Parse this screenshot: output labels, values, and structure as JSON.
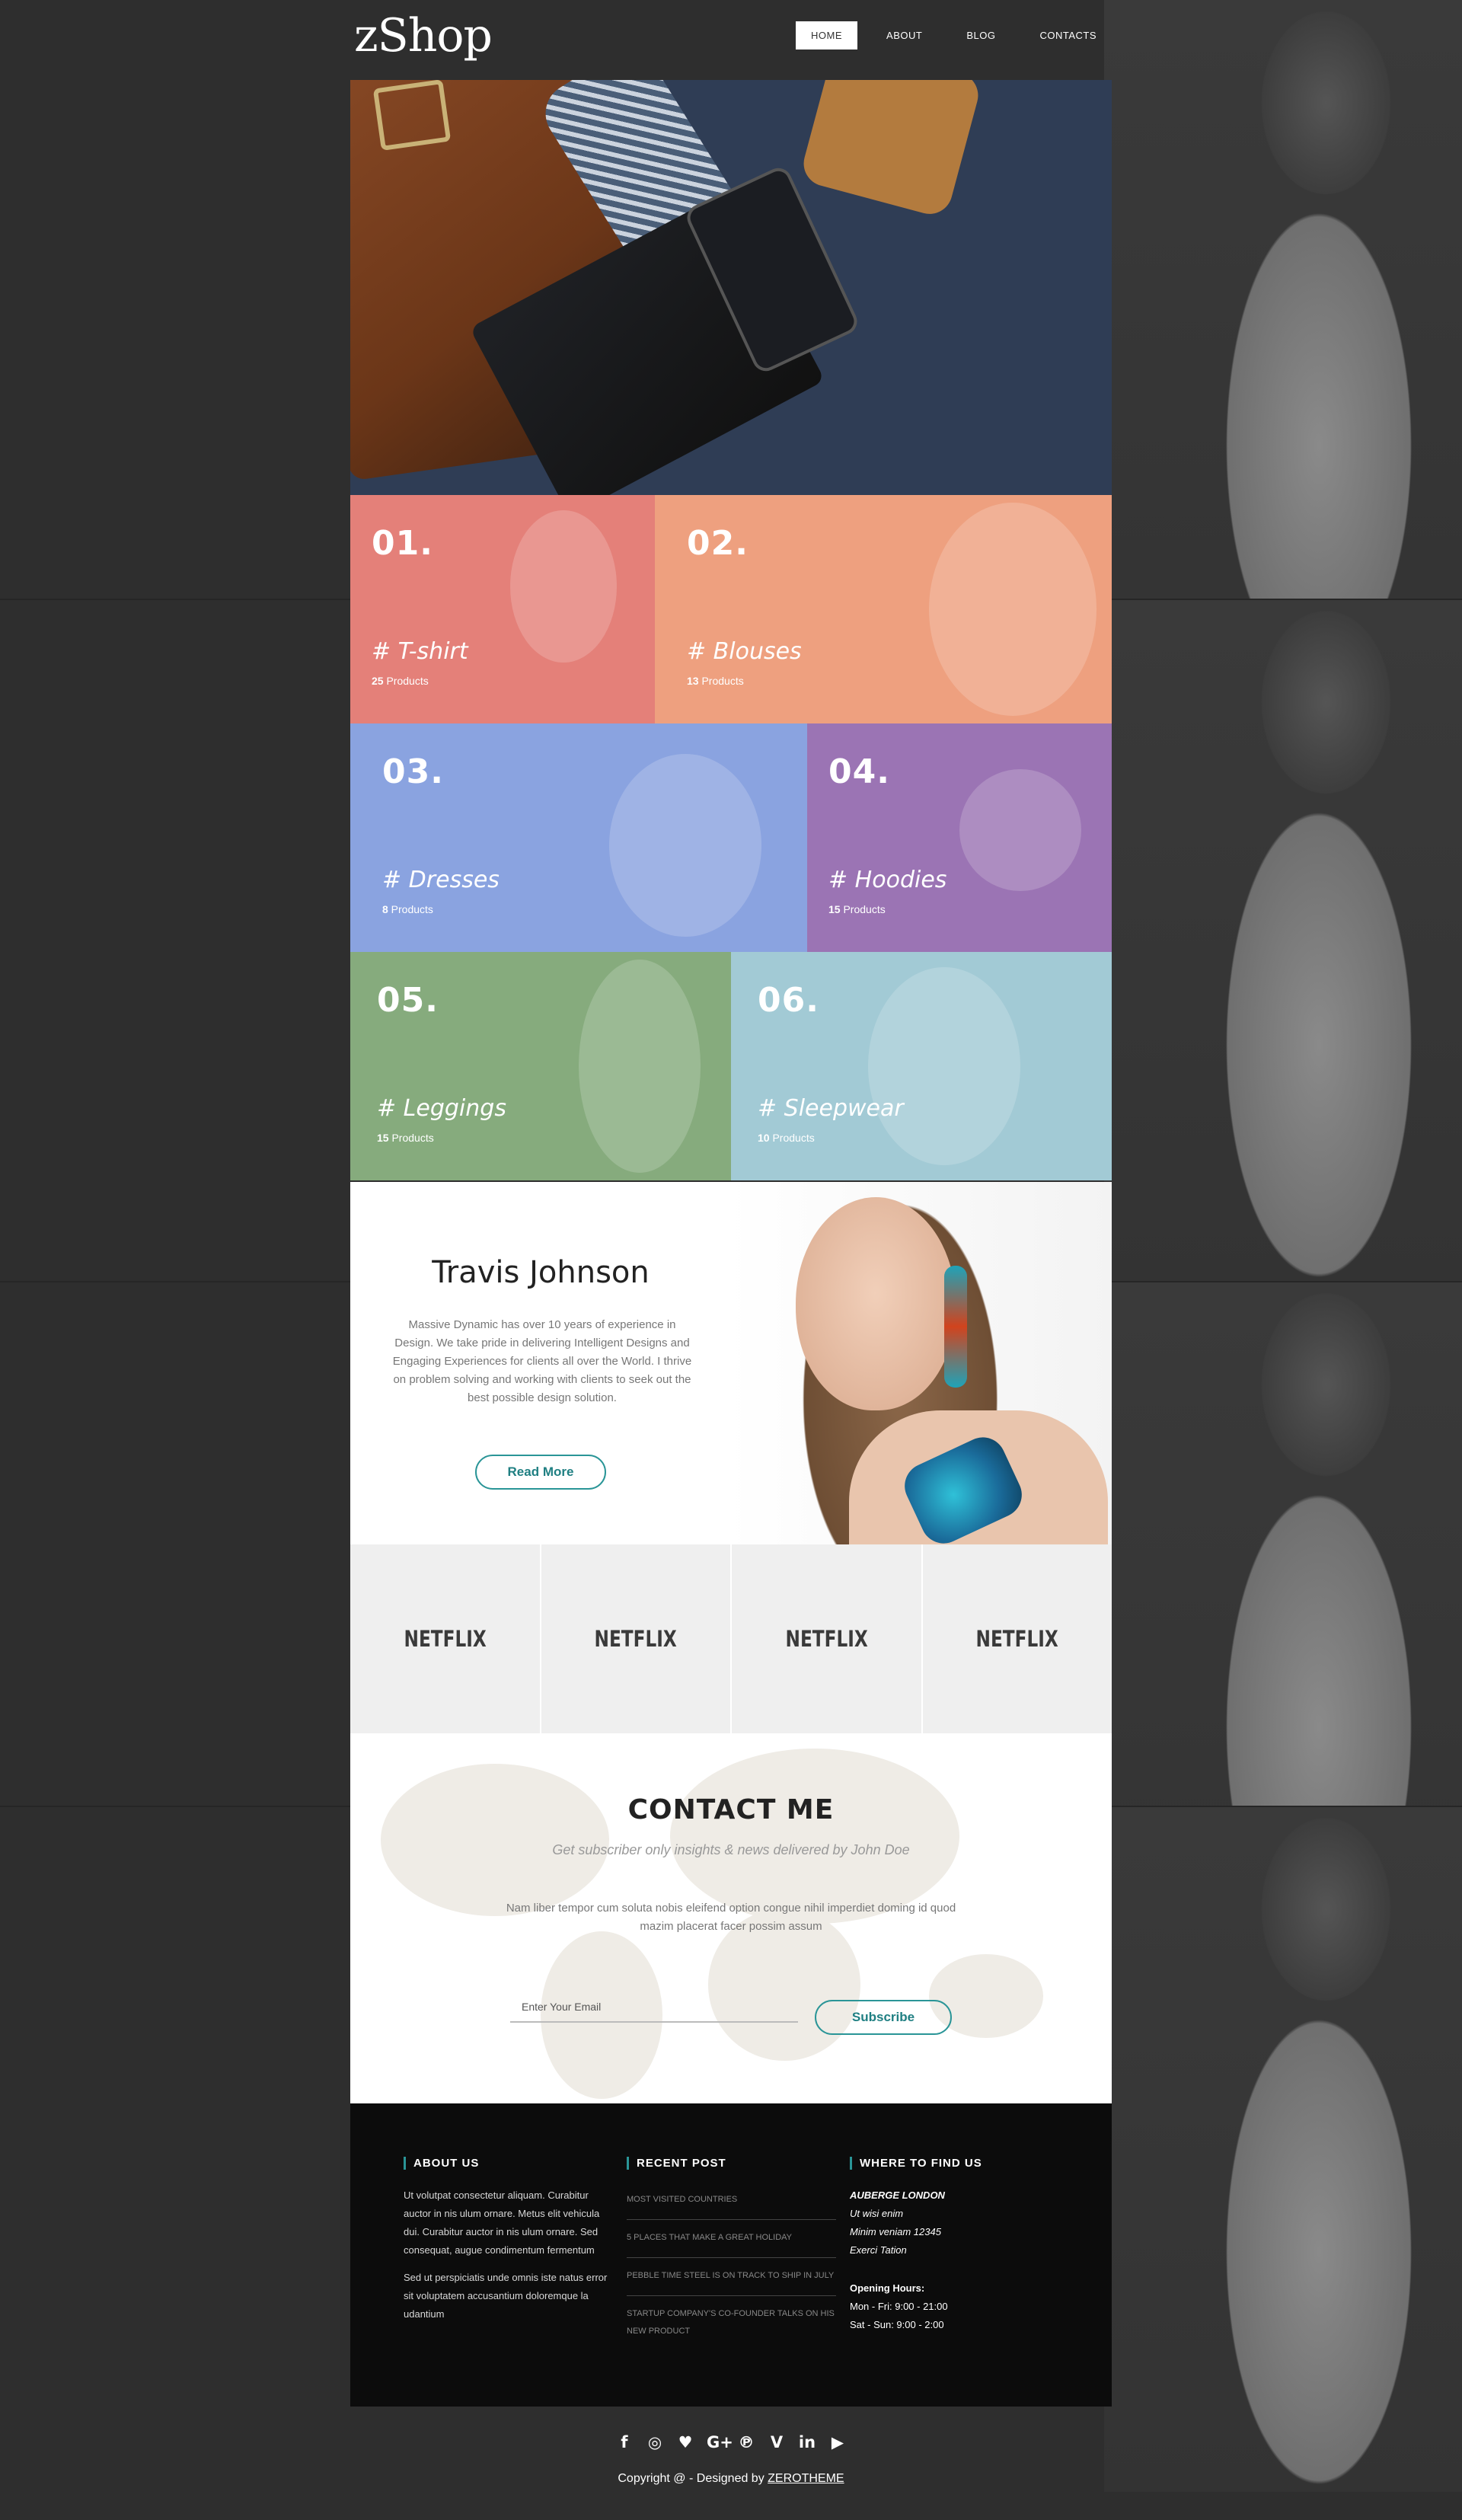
{
  "brand": {
    "logo": "zShop"
  },
  "nav": [
    {
      "label": "HOME",
      "active": true
    },
    {
      "label": "ABOUT",
      "active": false
    },
    {
      "label": "BLOG",
      "active": false
    },
    {
      "label": "CONTACTS",
      "active": false
    }
  ],
  "categories": [
    {
      "num": "01.",
      "name": "# T-shirt",
      "count": "25",
      "unit": " Products",
      "color": "#e48079"
    },
    {
      "num": "02.",
      "name": "# Blouses",
      "count": "13",
      "unit": " Products",
      "color": "#eea07f"
    },
    {
      "num": "03.",
      "name": "# Dresses",
      "count": "8",
      "unit": " Products",
      "color": "#8aa3e0"
    },
    {
      "num": "04.",
      "name": "# Hoodies",
      "count": "15",
      "unit": " Products",
      "color": "#9b74b4"
    },
    {
      "num": "05.",
      "name": "# Leggings",
      "count": "15",
      "unit": " Products",
      "color": "#86ab7d"
    },
    {
      "num": "06.",
      "name": "# Sleepwear",
      "count": "10",
      "unit": " Products",
      "color": "#a2cad5"
    }
  ],
  "about": {
    "name": "Travis Johnson",
    "text": "Massive Dynamic has over 10 years of experience in Design. We take pride in delivering Intelligent Designs and Engaging Experiences for clients all over the World. I thrive on problem solving and working with clients to seek out the best possible design solution.",
    "button": "Read More"
  },
  "partners": [
    "NETFLIX",
    "NETFLIX",
    "NETFLIX",
    "NETFLIX"
  ],
  "contact": {
    "title": "CONTACT ME",
    "subtitle": "Get subscriber only insights & news delivered by John Doe",
    "desc": "Nam liber tempor cum soluta nobis eleifend option congue nihil imperdiet doming id quod mazim placerat facer possim assum",
    "email_placeholder": "Enter Your Email",
    "subscribe": "Subscribe"
  },
  "footer": {
    "about": {
      "title": "ABOUT US",
      "p1": "Ut volutpat consectetur aliquam. Curabitur auctor in nis ulum ornare. Metus elit vehicula dui. Curabitur auctor in nis ulum ornare. Sed consequat, augue condimentum fermentum",
      "p2": "Sed ut perspiciatis unde omnis iste natus error sit voluptatem accusantium doloremque la udantium"
    },
    "recent": {
      "title": "RECENT POST",
      "posts": [
        "MOST VISITED COUNTRIES",
        "5 PLACES THAT MAKE A GREAT HOLIDAY",
        "PEBBLE TIME STEEL IS ON TRACK TO SHIP IN JULY",
        "STARTUP COMPANY'S CO-FOUNDER TALKS ON HIS NEW PRODUCT"
      ]
    },
    "find": {
      "title": "WHERE TO FIND US",
      "address": [
        "AUBERGE LONDON",
        "Ut wisi enim",
        "Minim veniam 12345",
        "Exerci Tation"
      ],
      "hours_title": "Opening Hours:",
      "hours": [
        "Mon - Fri: 9:00 - 21:00",
        "Sat - Sun: 9:00 - 2:00"
      ]
    }
  },
  "social_icons": [
    "facebook-icon",
    "instagram-icon",
    "twitter-icon",
    "google-plus-icon",
    "pinterest-icon",
    "vimeo-icon",
    "linkedin-icon",
    "youtube-icon"
  ],
  "social_glyphs": [
    "f",
    "◎",
    "♥",
    "G+",
    "℗",
    "V",
    "in",
    "▶"
  ],
  "copyright": {
    "text": "Copyright @ - Designed by ",
    "link": "ZEROTHEME"
  }
}
